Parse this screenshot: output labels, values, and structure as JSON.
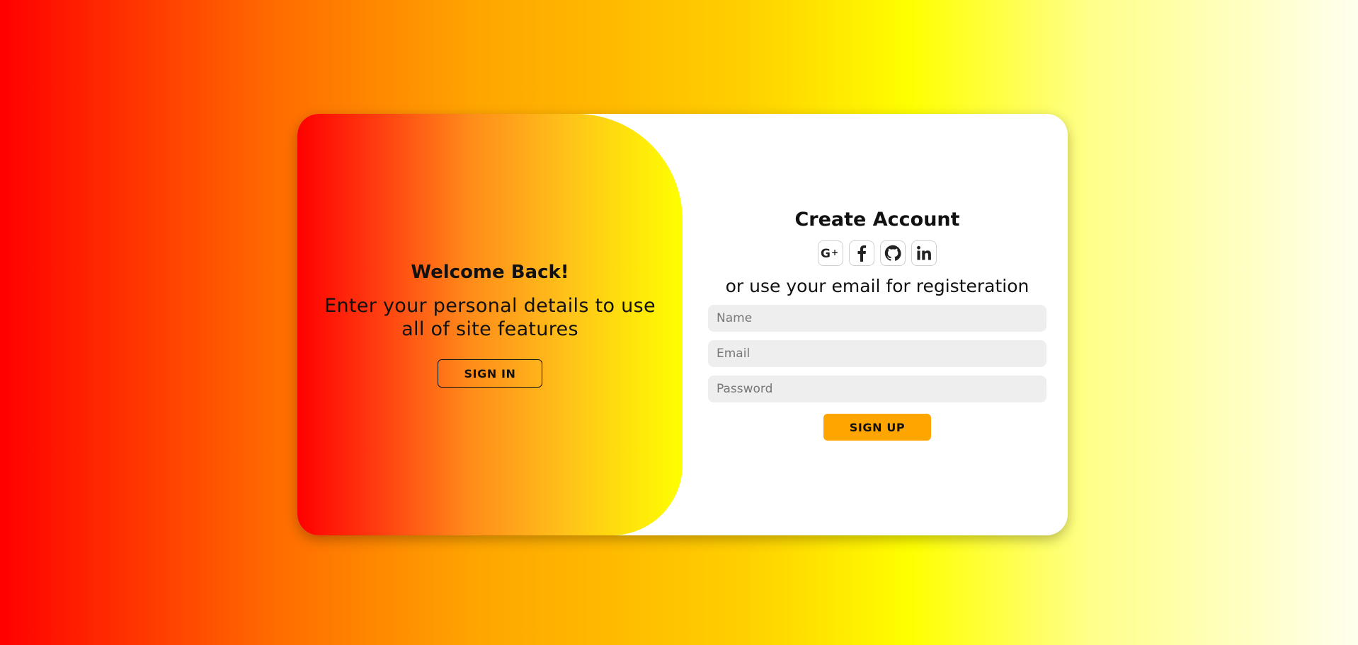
{
  "colors": {
    "accent": "#ffa500",
    "background_start": "#ff0000",
    "background_end": "#ffffee",
    "field_bg": "#eeeeee"
  },
  "toggle_panel": {
    "title": "Welcome Back!",
    "message": "Enter your personal details to use all of site features",
    "sign_in_label": "SIGN IN"
  },
  "form": {
    "title": "Create Account",
    "social_icons": [
      "google-plus-icon",
      "facebook-icon",
      "github-icon",
      "linkedin-icon"
    ],
    "subtitle": "or use your email for registeration",
    "name_placeholder": "Name",
    "email_placeholder": "Email",
    "password_placeholder": "Password",
    "sign_up_label": "SIGN UP"
  }
}
